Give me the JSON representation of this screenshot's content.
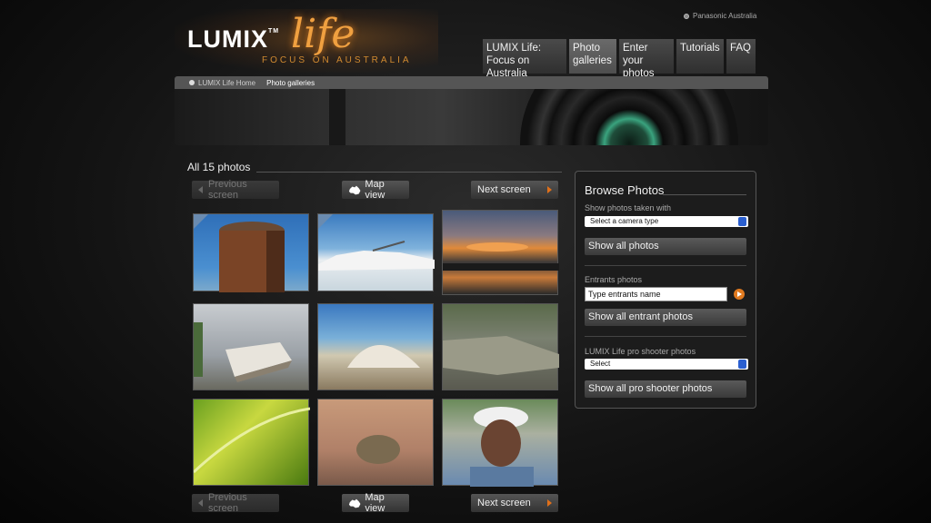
{
  "header": {
    "brand_link": "Panasonic Australia",
    "logo_main": "LUMIX",
    "logo_tm": "TM",
    "logo_script": "life",
    "logo_tagline": "FOCUS ON AUSTRALIA"
  },
  "nav": {
    "items": [
      {
        "label": "LUMIX Life:\nFocus on Australia"
      },
      {
        "label": "Photo\ngalleries"
      },
      {
        "label": "Enter your\nphotos"
      },
      {
        "label": "Tutorials"
      },
      {
        "label": "FAQ"
      }
    ],
    "active_index": 1
  },
  "breadcrumb": {
    "home": "LUMIX Life Home",
    "current": "Photo galleries"
  },
  "gallery": {
    "title": "All 15 photos",
    "prev_label": "Previous screen",
    "map_label": "Map view",
    "next_label": "Next screen"
  },
  "sidebar": {
    "title": "Browse Photos",
    "camera_label": "Show photos taken with",
    "camera_select": "Select a camera type",
    "show_all_label": "Show all photos",
    "entrants_label": "Entrants photos",
    "entrants_placeholder": "Type entrants name",
    "show_entrants_label": "Show all entrant photos",
    "pro_label": "LUMIX Life pro shooter photos",
    "pro_select": "Select",
    "show_pro_label": "Show all pro shooter photos"
  },
  "colors": {
    "accent": "#e07a20",
    "background": "#141414",
    "panel": "#1c1c1c"
  }
}
